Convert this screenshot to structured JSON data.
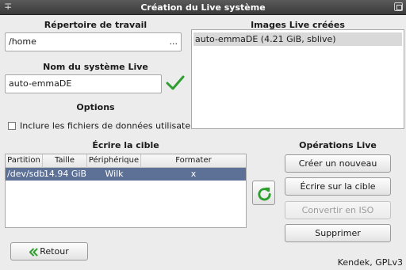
{
  "window": {
    "title": "Création du Live système"
  },
  "workdir": {
    "heading": "Répertoire de travail",
    "value": "/home",
    "browse_label": "..."
  },
  "live_name": {
    "heading": "Nom du système Live",
    "value": "auto-emmaDE"
  },
  "options": {
    "heading": "Options",
    "include_user_data_label": "Inclure les fichiers de données utilisateur",
    "include_user_data_checked": false
  },
  "live_images": {
    "heading": "Images Live créées",
    "items": [
      "auto-emmaDE (4.21 GiB, sblive)"
    ]
  },
  "target": {
    "heading": "Écrire la cible",
    "columns": [
      "Partition",
      "Taille",
      "Périphérique",
      "Formater"
    ],
    "rows": [
      {
        "partition": "/dev/sdb",
        "size": "14.94 GiB",
        "device": "Wilk",
        "format": "x"
      }
    ]
  },
  "operations": {
    "heading": "Opérations Live",
    "create_label": "Créer un nouveau",
    "write_label": "Écrire sur la cible",
    "convert_label": "Convertir en ISO",
    "delete_label": "Supprimer"
  },
  "footer": {
    "back_label": "Retour",
    "credit": "Kendek, GPLv3"
  },
  "colors": {
    "selection": "#5d7196",
    "accent_green": "#2e9e2e"
  }
}
